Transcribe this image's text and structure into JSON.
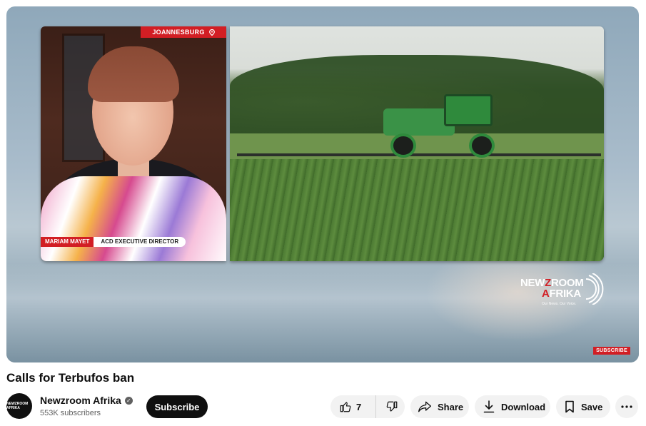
{
  "video": {
    "location_tag": "JOANNESBURG",
    "guest_name": "MARIAM MAYET",
    "guest_role": "ACD EXECUTIVE DIRECTOR",
    "brand": {
      "part1": "NEW",
      "z": "Z",
      "part2": "ROOM",
      "part3": "FRIKA",
      "a": "A",
      "tagline": "Our News. Our Voice."
    },
    "subscribe_badge": "SUBSCRIBE"
  },
  "title": "Calls for Terbufos ban",
  "channel": {
    "avatar_text": "NEWZROOM AFRIKA",
    "name": "Newzroom Afrika",
    "subscribers": "553K subscribers",
    "subscribe_label": "Subscribe"
  },
  "actions": {
    "like_count": "7",
    "share_label": "Share",
    "download_label": "Download",
    "save_label": "Save"
  },
  "colors": {
    "brand_red": "#d21e24",
    "button_dark": "#0f0f0f",
    "pill_bg": "#f2f2f2"
  }
}
